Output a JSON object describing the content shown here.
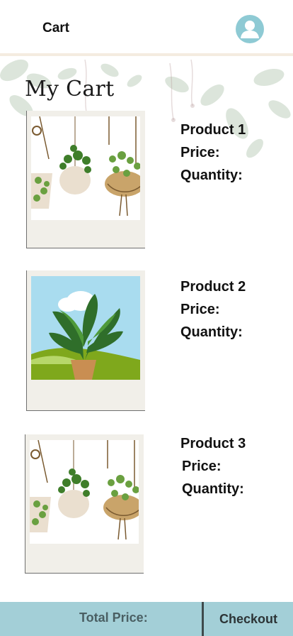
{
  "header": {
    "title": "Cart",
    "avatar_icon": "user-avatar-icon"
  },
  "page": {
    "title": "My Cart"
  },
  "products": [
    {
      "name": "Product 1",
      "price_label": "Price:",
      "quantity_label": "Quantity:",
      "image": "hanging-plants-image"
    },
    {
      "name": "Product  2",
      "price_label": "Price:",
      "quantity_label": "Quantity:",
      "image": "monstera-plant-image"
    },
    {
      "name": "Product  3",
      "price_label": "Price:",
      "quantity_label": "Quantity:",
      "image": "hanging-plants-image"
    }
  ],
  "footer": {
    "total_label": "Total Price:",
    "checkout_label": "Checkout"
  },
  "colors": {
    "footer_bg": "#a3cfd7",
    "avatar": "#8ecad4",
    "card_bg": "#f1efe9"
  }
}
